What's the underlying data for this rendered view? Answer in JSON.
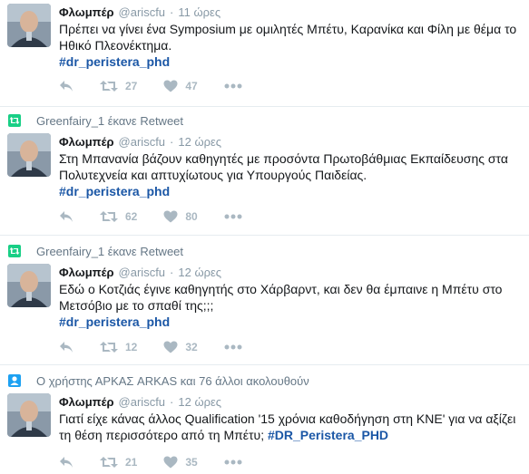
{
  "tweets": [
    {
      "context": null,
      "name": "Φλωμπέρ",
      "handle": "@ariscfu",
      "time": "11 ώρες",
      "text_parts": [
        "Πρέπει να γίνει ένα Symposium με ομιλητές Μπέτυ, Καρανίκα και Φίλη με θέμα το Ηθικό Πλεονέκτημα."
      ],
      "hashtag": "#dr_peristera_phd",
      "retweets": "27",
      "likes": "47"
    },
    {
      "context": {
        "icon": "retweet-icon",
        "text": "Greenfairy_1 έκανε Retweet"
      },
      "name": "Φλωμπέρ",
      "handle": "@ariscfu",
      "time": "12 ώρες",
      "text_parts": [
        "Στη Μπανανία βάζουν καθηγητές με προσόντα Πρωτοβάθμιας Εκπαίδευσης στα Πολυτεχνεία και απτυχίωτους για Υπουργούς Παιδείας."
      ],
      "hashtag": "#dr_peristera_phd",
      "retweets": "62",
      "likes": "80"
    },
    {
      "context": {
        "icon": "retweet-icon",
        "text": "Greenfairy_1 έκανε Retweet"
      },
      "name": "Φλωμπέρ",
      "handle": "@ariscfu",
      "time": "12 ώρες",
      "text_parts": [
        "Εδώ ο Κοτζιάς έγινε καθηγητής στο Χάρβαρντ, και δεν θα έμπαινε η Μπέτυ στο Μετσόβιο με το σπαθί της;;;"
      ],
      "hashtag": "#dr_peristera_phd",
      "retweets": "12",
      "likes": "32"
    },
    {
      "context": {
        "icon": "follow-icon",
        "text": "Ο χρήστης ΑΡΚΑΣ ARKAS και 76 άλλοι ακολουθούν"
      },
      "name": "Φλωμπέρ",
      "handle": "@ariscfu",
      "time": "12 ώρες",
      "text_parts": [
        "Γιατί είχε κάνας άλλος Qualification '15 χρόνια καθοδήγηση στη ΚΝΕ' για να αξίζει τη θέση περισσότερο από τη Μπέτυ;"
      ],
      "hashtag": "#DR_Peristera_PHD",
      "retweets": "21",
      "likes": "35"
    }
  ],
  "colors": {
    "accent": "#1b57a6",
    "retweet_context": "#19cf86",
    "muted": "#8899a6",
    "action": "#aab8c2"
  }
}
